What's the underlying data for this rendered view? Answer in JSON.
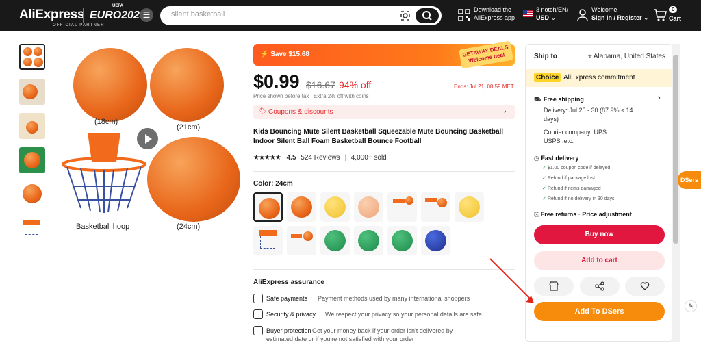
{
  "header": {
    "logo": "AliExpress",
    "partner": "OFFICIAL PARTNER",
    "euro": "EURO2024",
    "uefa": "UEFA",
    "search_value": "silent basketball",
    "download_line1": "Download the",
    "download_line2": "AliExpress app",
    "locale_line1": "3 notch/EN/",
    "locale_line2": "USD",
    "welcome_line1": "Welcome",
    "welcome_line2": "Sign in / Register",
    "cart_count": "0",
    "cart_label": "Cart"
  },
  "gallery": {
    "label_18": "(18cm)",
    "label_21": "(21cm)",
    "label_24": "(24cm)",
    "label_hoop": "Basketball hoop"
  },
  "product": {
    "promo_save": "Save $15.68",
    "getaway_line1": "GETAWAY DEALS",
    "getaway_line2": "Welcome deal",
    "price": "$0.99",
    "old_price": "$16.67",
    "discount": "94% off",
    "ends": "Ends: Jul 21, 08:59 MET",
    "price_note": "Price shown before tax  |  Extra 2% off with coins",
    "coupons": "Coupons & discounts",
    "title": "Kids Bouncing Mute Silent Basketball Squeezable Mute Bouncing Basketball Indoor Silent Ball Foam Basketball Bounce Football",
    "stars": "★★★★★",
    "rating": "4.5",
    "reviews": "524 Reviews",
    "sold": "4,000+ sold",
    "color_label": "Color: 24cm"
  },
  "assurance": {
    "title": "AliExpress assurance",
    "rows": [
      {
        "label": "Safe payments",
        "text": "Payment methods used by many international shoppers"
      },
      {
        "label": "Security & privacy",
        "text": "We respect your privacy so your personal details are safe"
      },
      {
        "label": "Buyer protection",
        "text": "Get your money back if your order isn't delivered by"
      },
      {
        "label": "",
        "text": "estimated date or if you're not satisfied with your order"
      }
    ]
  },
  "sidebar": {
    "ship_to": "Ship to",
    "location": "Alabama, United States",
    "choice_tag": "Choice",
    "choice_text": "AliExpress commitment",
    "free_shipping": "Free shipping",
    "delivery_line1": "Delivery: Jul 25 - 30 (87.9% ≤ 14",
    "delivery_line2": "days)",
    "courier_line1": "Courier company:  UPS",
    "courier_line2": "USPS ,etc.",
    "fast_delivery": "Fast delivery",
    "checks": [
      "$1.00 coupon code if delayed",
      "Refund if package lost",
      "Refund if items damaged",
      "Refund if no delivery in 30 days"
    ],
    "free_returns": "Free returns · Price adjustment",
    "buy_now": "Buy now",
    "add_to_cart": "Add to cart",
    "add_to_dsers": "Add To DSers"
  },
  "dsers_tab": "DSers",
  "colors": {
    "accent": "#e1173f",
    "dsers": "#f78c0c",
    "price_red": "#e62e2e"
  }
}
